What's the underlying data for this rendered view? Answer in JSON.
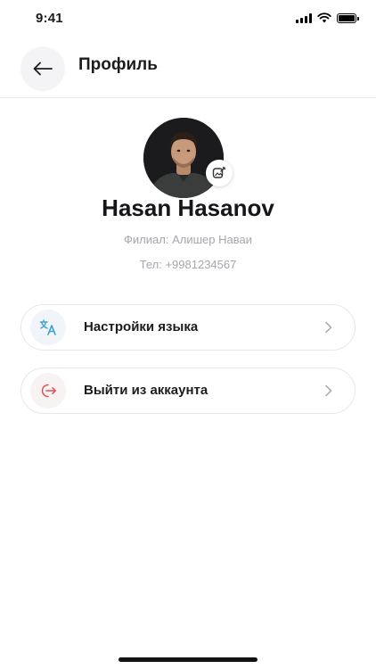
{
  "status_bar": {
    "time": "9:41"
  },
  "header": {
    "title": "Профиль"
  },
  "profile": {
    "name": "Hasan Hasanov",
    "branch": "Филиал: Алишер Наваи",
    "phone": "Тел: +9981234567"
  },
  "menu": {
    "items": [
      {
        "label": "Настройки языка",
        "icon": "translate-icon",
        "icon_color": "#3aa0d8"
      },
      {
        "label": "Выйти из аккаунта",
        "icon": "logout-icon",
        "icon_color": "#e05252"
      }
    ]
  },
  "colors": {
    "text_primary": "#1c1c1e",
    "text_secondary": "#a6a6ad",
    "border": "#e7e7ea"
  }
}
